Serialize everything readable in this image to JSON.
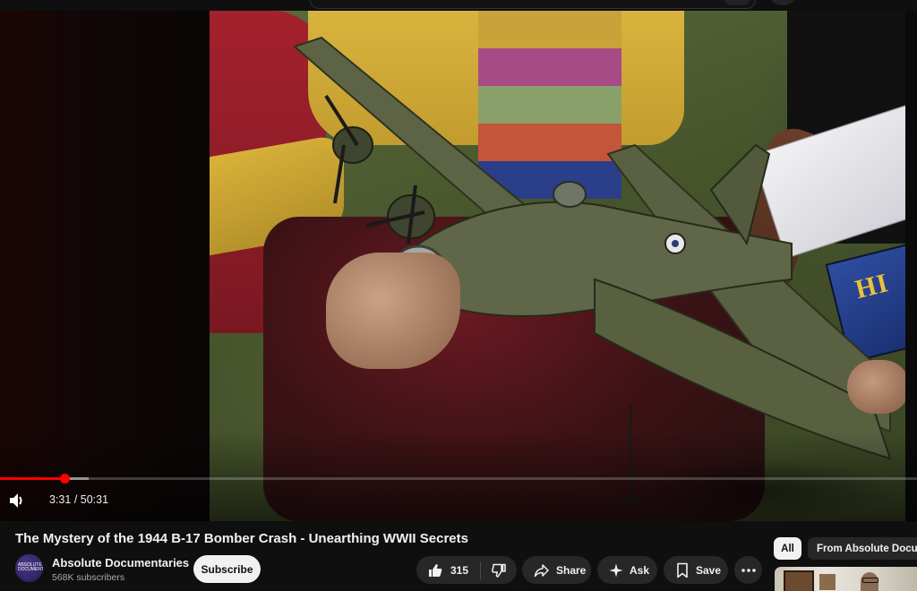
{
  "player": {
    "time_current": "3:31",
    "time_total": "50:31",
    "time_separator": " / ",
    "progress_played_fraction": 0.07,
    "progress_buffered_fraction": 0.097,
    "accent_color": "#ff0000",
    "booklet_letters": "HI"
  },
  "video": {
    "title": "The Mystery of the 1944 B-17 Bomber Crash - Unearthing WWII Secrets"
  },
  "channel": {
    "name": "Absolute Documentaries",
    "subscribers": "568K subscribers",
    "avatar_text": "ABSOLUTE DOCUMENTARIES",
    "subscribe_label": "Subscribe"
  },
  "actions": {
    "like_count": "315",
    "share_label": "Share",
    "ask_label": "Ask",
    "save_label": "Save"
  },
  "sidebar": {
    "chips": [
      {
        "label": "All",
        "selected": true
      },
      {
        "label": "From Absolute Docume",
        "selected": false
      }
    ]
  },
  "icons": {
    "volume": "volume-icon",
    "like": "thumbs-up-icon",
    "dislike": "thumbs-down-icon",
    "share": "share-arrow-icon",
    "ask": "sparkle-icon",
    "save": "bookmark-icon",
    "more": "more-horizontal-icon"
  }
}
